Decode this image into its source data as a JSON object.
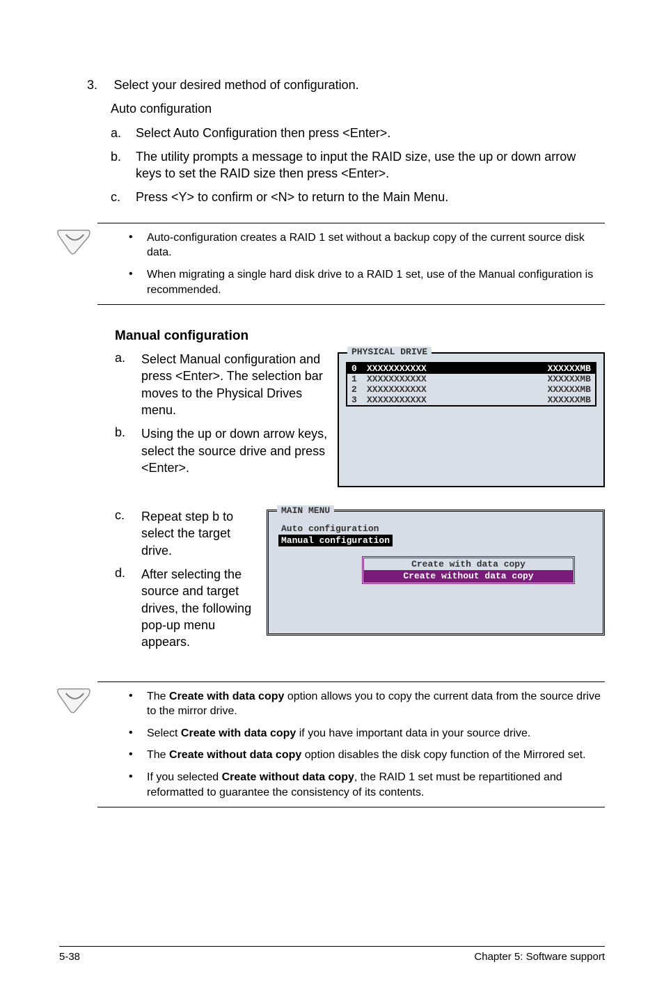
{
  "step3": {
    "number": "3.",
    "text": "Select your desired method of configuration.",
    "auto_heading": "Auto configuration",
    "sub": {
      "a": {
        "letter": "a.",
        "text": "Select Auto Configuration then press <Enter>."
      },
      "b": {
        "letter": "b.",
        "text": "The utility prompts a message to input the RAID size, use the up or down arrow keys to set the RAID size then press <Enter>."
      },
      "c": {
        "letter": "c.",
        "text": "Press <Y> to confirm or <N> to return to the Main Menu."
      }
    }
  },
  "note1": {
    "items": [
      "Auto-configuration creates a RAID 1 set without a backup copy of the current source disk data.",
      "When migrating a single hard disk drive to a RAID 1 set, use of the Manual configuration is recommended."
    ]
  },
  "manual": {
    "heading": "Manual configuration",
    "a": {
      "letter": "a.",
      "text": "Select  Manual configuration and press <Enter>. The selection bar moves to the Physical Drives menu."
    },
    "b": {
      "letter": "b.",
      "text": "Using the up or down arrow keys, select the source drive and press <Enter>."
    },
    "c": {
      "letter": "c.",
      "text": "Repeat step b to select the target drive."
    },
    "d": {
      "letter": "d.",
      "text": "After selecting the source and target drives, the following pop-up menu appears."
    }
  },
  "physical_drive": {
    "title": "PHYSICAL DRIVE",
    "rows": [
      {
        "idx": "0",
        "name": "XXXXXXXXXXX",
        "size": "XXXXXXMB"
      },
      {
        "idx": "1",
        "name": "XXXXXXXXXXX",
        "size": "XXXXXXMB"
      },
      {
        "idx": "2",
        "name": "XXXXXXXXXXX",
        "size": "XXXXXXMB"
      },
      {
        "idx": "3",
        "name": "XXXXXXXXXXX",
        "size": "XXXXXXMB"
      }
    ]
  },
  "main_menu": {
    "title": "MAIN MENU",
    "items": {
      "auto": "Auto configuration",
      "manual": "Manual configuration"
    },
    "popup": {
      "a": "Create with data copy",
      "b": "Create without data copy"
    }
  },
  "note2": {
    "items": [
      {
        "pre": "The ",
        "bold": "Create with data copy",
        "post": " option allows you to copy the current data from the source drive to the mirror drive."
      },
      {
        "pre": "Select ",
        "bold": "Create with data copy",
        "post": " if you have important data in your source drive."
      },
      {
        "pre": "The ",
        "bold": "Create without data copy",
        "post": " option disables the disk copy function of the Mirrored set."
      },
      {
        "pre": "If you selected ",
        "bold": "Create without data copy",
        "post": ", the RAID 1 set must be repartitioned and reformatted to guarantee the consistency of its contents."
      }
    ]
  },
  "footer": {
    "left": "5-38",
    "right": "Chapter 5: Software support"
  }
}
